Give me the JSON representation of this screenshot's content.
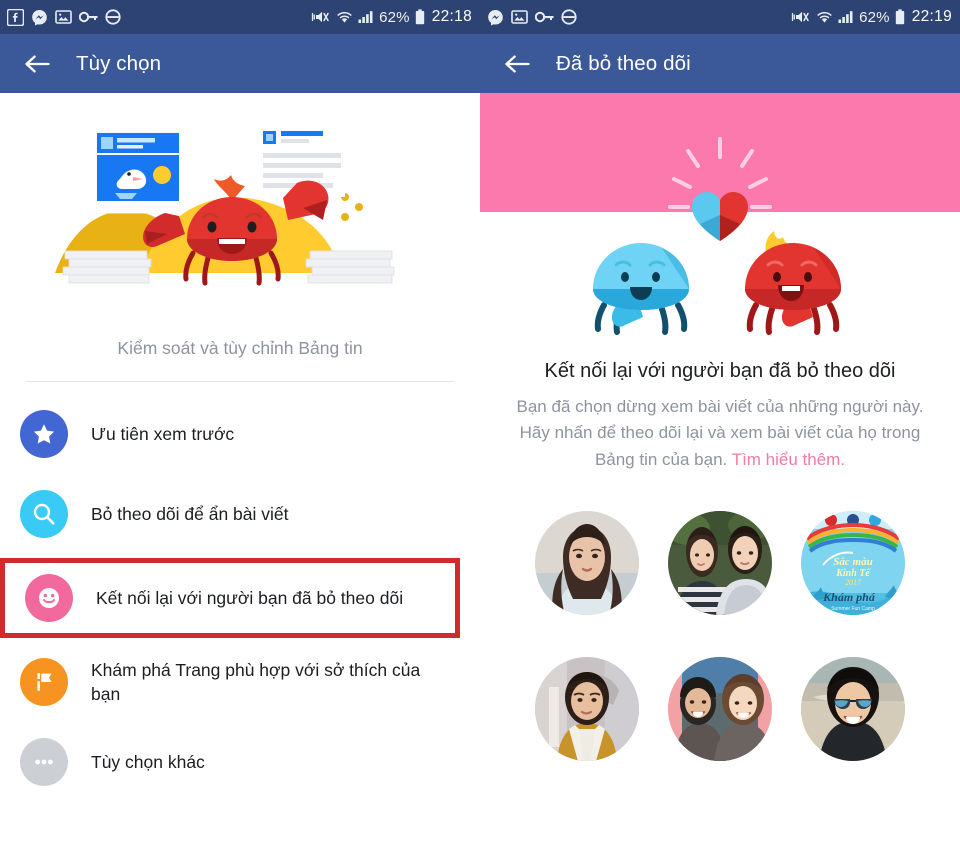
{
  "left_screen": {
    "statusbar": {
      "icons": [
        "facebook-icon",
        "messenger-icon",
        "photo-icon",
        "vpn-key-icon",
        "dnd-circle-icon"
      ],
      "mute_icon": "vibrate-mute-icon",
      "wifi_icon": "wifi-icon",
      "signal_icon": "cellular-signal-icon",
      "battery_percent": "62%",
      "battery_icon": "battery-icon",
      "time": "22:18"
    },
    "appbar": {
      "back_icon": "back-arrow-icon",
      "title": "Tùy chọn"
    },
    "illustration_name": "crab-newsfeed-illustration",
    "caption": "Kiểm soát và tùy chỉnh Bảng tin",
    "menu_items": [
      {
        "icon": "star-icon",
        "icon_color": "#4267d2",
        "label": "Ưu tiên xem trước",
        "highlighted": false
      },
      {
        "icon": "search-icon",
        "icon_color": "#39caf5",
        "label": "Bỏ theo dõi để ẩn bài viết",
        "highlighted": false
      },
      {
        "icon": "smiley-face-icon",
        "icon_color": "#f2699e",
        "label": "Kết nối lại với người bạn đã bỏ theo dõi",
        "highlighted": true
      },
      {
        "icon": "flag-icon",
        "icon_color": "#f79421",
        "label": "Khám phá Trang phù hợp với sở thích của bạn",
        "highlighted": false
      },
      {
        "icon": "ellipsis-icon",
        "icon_color": "#ccd0d5",
        "label": "Tùy chọn khác",
        "highlighted": false
      }
    ],
    "highlight_color": "#d32b2b"
  },
  "right_screen": {
    "statusbar": {
      "icons": [
        "messenger-icon",
        "photo-icon",
        "vpn-key-icon",
        "dnd-circle-icon"
      ],
      "mute_icon": "vibrate-mute-icon",
      "wifi_icon": "wifi-icon",
      "signal_icon": "cellular-signal-icon",
      "battery_percent": "62%",
      "battery_icon": "battery-icon",
      "time": "22:19"
    },
    "appbar": {
      "back_icon": "back-arrow-icon",
      "title": "Đã bỏ theo dõi"
    },
    "banner_color": "#fb79ac",
    "illustration_name": "two-crabs-heart-illustration",
    "headline": "Kết nối lại với người bạn đã bỏ theo dõi",
    "subtext": "Bạn đã chọn dừng xem bài viết của những người này. Hãy nhấn để theo dõi lại và xem bài viết của họ trong Bảng tin của bạn. ",
    "learn_more": "Tìm hiểu thêm.",
    "learn_more_color": "#f27ba5",
    "avatars": [
      {
        "name": "avatar-woman-long-hair"
      },
      {
        "name": "avatar-couple-outdoor"
      },
      {
        "name": "avatar-event-poster"
      },
      {
        "name": "avatar-man-yellow-jacket"
      },
      {
        "name": "avatar-couple-pink-background"
      },
      {
        "name": "avatar-man-sunglasses-beach"
      }
    ]
  }
}
